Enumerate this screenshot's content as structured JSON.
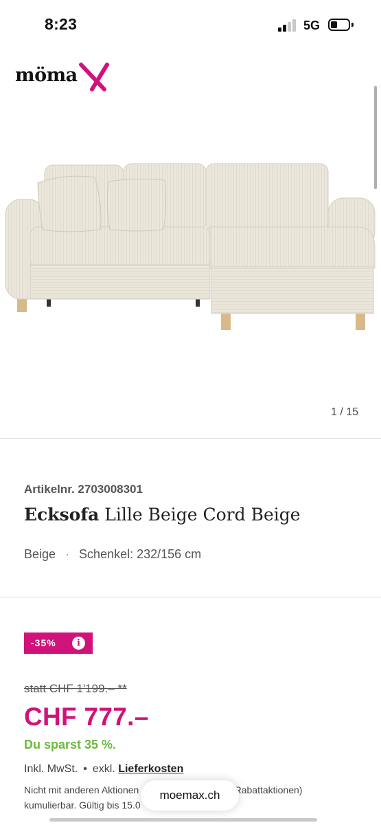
{
  "status_bar": {
    "time": "8:23",
    "network": "5G"
  },
  "brand": {
    "logo_text": "möma",
    "accent_color": "#d0127a"
  },
  "gallery": {
    "counter": "1 / 15",
    "image": "beige-corduroy-corner-sofa"
  },
  "product": {
    "article_number": "Artikelnr. 2703008301",
    "title_bold": "Ecksofa",
    "title_rest": " Lille Beige Cord Beige",
    "color": "Beige",
    "dimensions": "Schenkel: 232/156 cm"
  },
  "pricing": {
    "discount_badge": "-35%",
    "old_price": "statt CHF 1'199.– **",
    "price": "CHF 777.–",
    "saving": "Du sparst 35 %.",
    "tax_prefix": "Inkl. MwSt.",
    "tax_dot": "•",
    "tax_delivery_prefix": "exkl.",
    "tax_delivery_link": "Lieferkosten",
    "note": "Nicht mit anderen Aktionen (inkl. Gutscheine und Rabattaktionen) kumulierbar. Gültig bis 15.0"
  },
  "browser": {
    "url": "moemax.ch"
  }
}
